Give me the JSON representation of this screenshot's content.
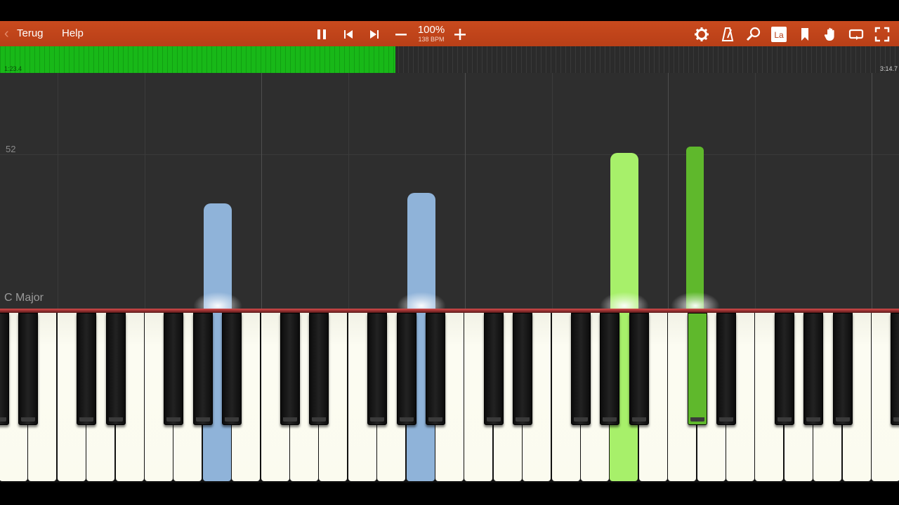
{
  "toolbar": {
    "back_label": "Terug",
    "help_label": "Help",
    "tempo_percent": "100%",
    "tempo_bpm": "138 BPM",
    "icons": [
      "pause-icon",
      "skip-back-icon",
      "skip-forward-icon",
      "minus-icon",
      "plus-icon",
      "gear-icon",
      "metronome-icon",
      "search-icon",
      "labels-icon",
      "bookmark-icon",
      "hand-icon",
      "loop-icon",
      "fullscreen-icon"
    ],
    "labels_icon_text": "La"
  },
  "progress": {
    "elapsed": "1:23.4",
    "total": "3:14.7",
    "fraction": 0.44,
    "fill_color": "#18b818"
  },
  "roll": {
    "measure_number": "52",
    "key_signature": "C Major"
  },
  "colors": {
    "left_hand": "#8fb3d9",
    "right_hand_light": "#a7f06a",
    "right_hand_dark": "#5fb82c",
    "toolbar": "#c24519"
  }
}
